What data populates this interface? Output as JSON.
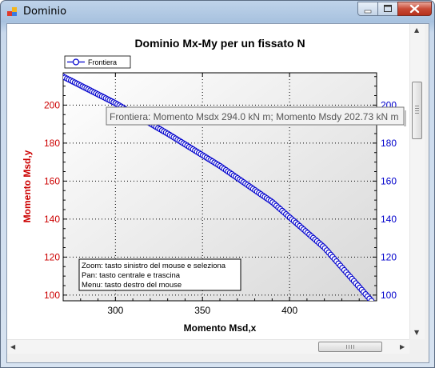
{
  "window": {
    "title": "Dominio"
  },
  "chart_data": {
    "type": "scatter",
    "title": "Dominio Mx-My per un fissato N",
    "xlabel": "Momento Msd,x",
    "ylabel": "Momento Msd,y",
    "xlim": [
      270,
      450
    ],
    "ylim": [
      97,
      217
    ],
    "xticks": [
      300,
      350,
      400
    ],
    "yticks": [
      100,
      120,
      140,
      160,
      180,
      200
    ],
    "y2ticks": [
      100,
      120,
      140,
      160,
      180,
      200
    ],
    "grid": true,
    "legend_position": "top-left",
    "series": [
      {
        "name": "Frontiera",
        "marker": "circle",
        "color": "#0000cc",
        "x_start": 270,
        "y_start": 215,
        "x_end": 447,
        "y_end": 97,
        "curve_points": [
          [
            270,
            215
          ],
          [
            300,
            201
          ],
          [
            330,
            185
          ],
          [
            360,
            168
          ],
          [
            390,
            149
          ],
          [
            420,
            125
          ],
          [
            447,
            97
          ]
        ],
        "count": 160
      }
    ],
    "tooltip": "Frontiera: Momento Msdx 294.0 kN m; Momento Msdy 202.73 kN m",
    "info_lines": [
      "Zoom: tasto sinistro del mouse e seleziona",
      "Pan: tasto centrale e trascina",
      "Menu: tasto destro del mouse"
    ]
  },
  "colors": {
    "left_axis": "#cc0000",
    "right_axis": "#0000cc",
    "title": "#000000"
  }
}
